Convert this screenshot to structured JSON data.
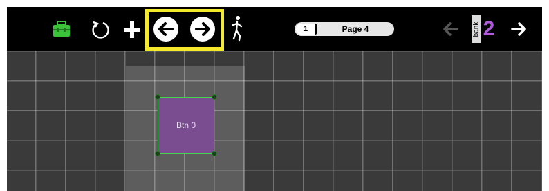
{
  "toolbar": {
    "items": [
      {
        "name": "toolbox-icon",
        "color": "#3bc23b"
      },
      {
        "name": "reset-icon"
      },
      {
        "name": "add-icon"
      },
      {
        "name": "back-icon",
        "highlighted": true
      },
      {
        "name": "forward-icon",
        "highlighted": true
      },
      {
        "name": "exit-icon"
      }
    ],
    "highlight_color": "#f5e92c"
  },
  "page": {
    "number": "1",
    "name": "Page 4"
  },
  "bank": {
    "label": "bank",
    "number": "2",
    "number_color": "#b15be0",
    "prev_icon": "arrow-left-icon",
    "next_icon": "arrow-right-icon",
    "prev_enabled": false,
    "next_enabled": true
  },
  "canvas": {
    "selected_button": {
      "label": "Btn 0",
      "fill_color": "#7a4c90",
      "border_color": "#43d54b"
    }
  }
}
